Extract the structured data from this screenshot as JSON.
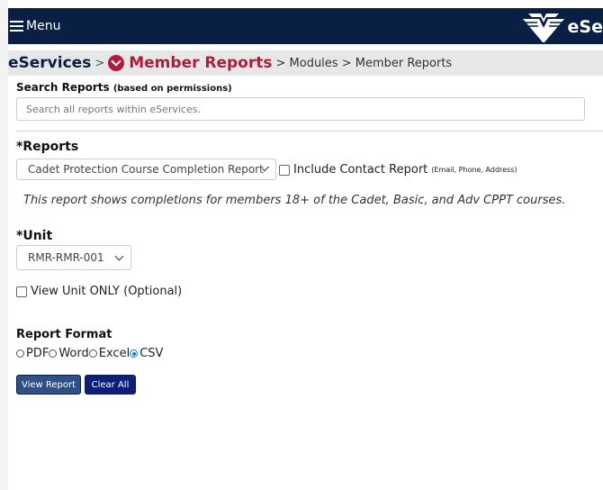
{
  "header": {
    "menu_label": "Menu",
    "logo_text": "eSe"
  },
  "breadcrumb": {
    "root": "eServices",
    "sep": ">",
    "section": "Member Reports",
    "rest": "> Modules > Member Reports"
  },
  "search": {
    "label": "Search Reports",
    "label_note": "(based on permissions)",
    "placeholder": "Search all reports within eServices."
  },
  "reports": {
    "label": "*Reports",
    "selected": "Cadet Protection Course Completion Report",
    "include_contact_label": "Include Contact Report",
    "include_contact_note": "(Email, Phone, Address)",
    "description": "This report shows completions for members 18+ of the Cadet, Basic, and Adv CPPT courses."
  },
  "unit": {
    "label": "*Unit",
    "selected": "RMR-RMR-001",
    "view_only_label": "View Unit ONLY (Optional)"
  },
  "format": {
    "label": "Report Format",
    "options": [
      "PDF",
      "Word",
      "Excel",
      "CSV"
    ],
    "selected": "CSV"
  },
  "actions": {
    "view_report": "View Report",
    "clear_all": "Clear All"
  },
  "colors": {
    "navy": "#0a1f44",
    "accent": "#b01c3c",
    "button_primary": "#2f4f86",
    "button_secondary": "#0d1f7a"
  }
}
